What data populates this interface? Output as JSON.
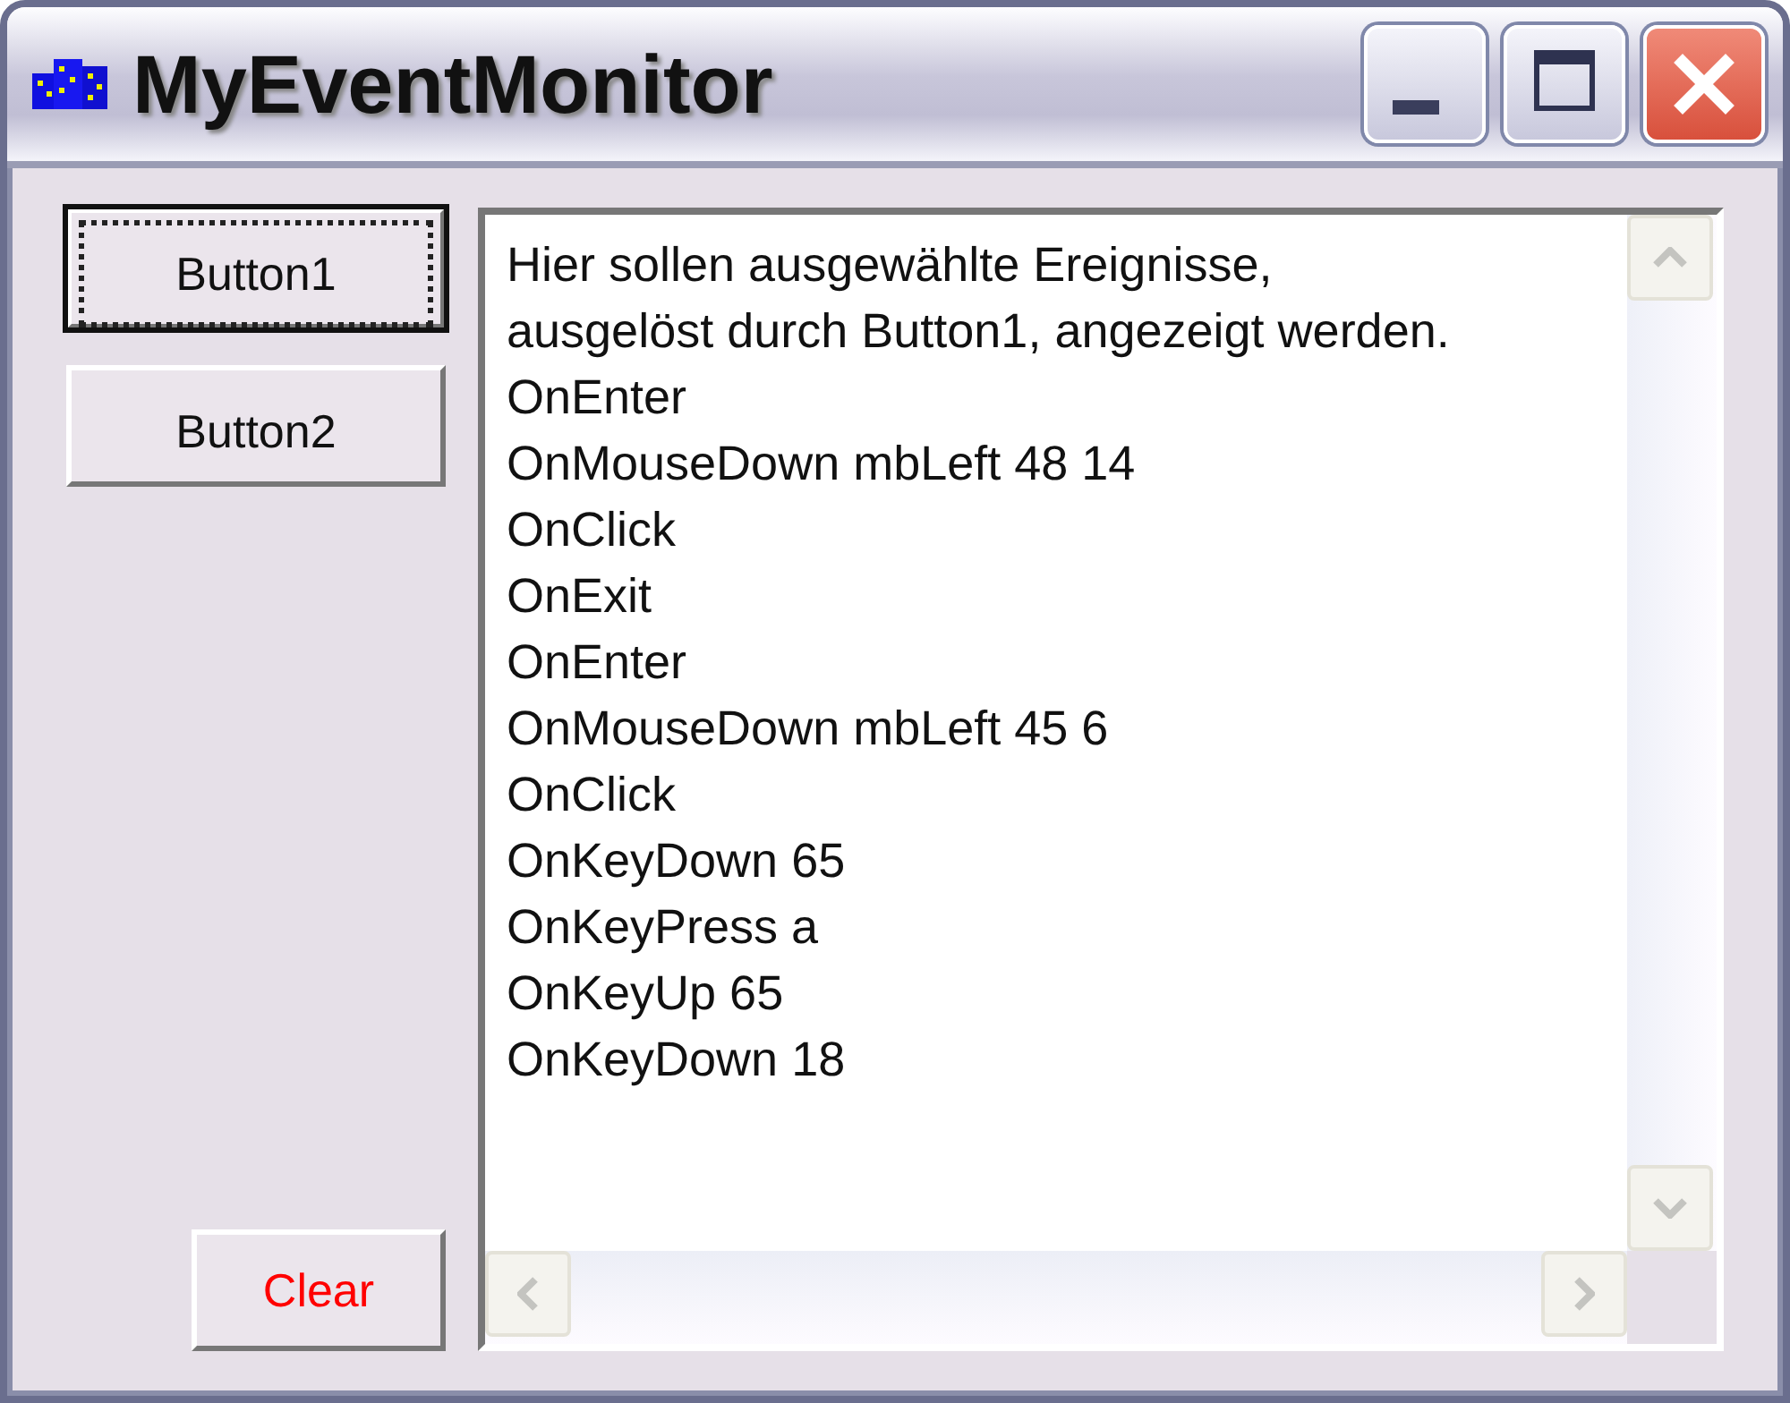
{
  "window": {
    "title": "MyEventMonitor"
  },
  "buttons": [
    {
      "label": "Button1",
      "focused": true
    },
    {
      "label": "Button2",
      "focused": false
    }
  ],
  "clear_button": {
    "label": "Clear"
  },
  "log": {
    "lines": [
      "Hier sollen ausgewählte Ereignisse,",
      "ausgelöst durch Button1, angezeigt werden.",
      "OnEnter",
      "OnMouseDown mbLeft 48 14",
      "OnClick",
      "OnExit",
      "OnEnter",
      "OnMouseDown mbLeft 45 6",
      "OnClick",
      "OnKeyDown 65",
      "OnKeyPress a",
      "OnKeyUp 65",
      "OnKeyDown 18"
    ]
  }
}
